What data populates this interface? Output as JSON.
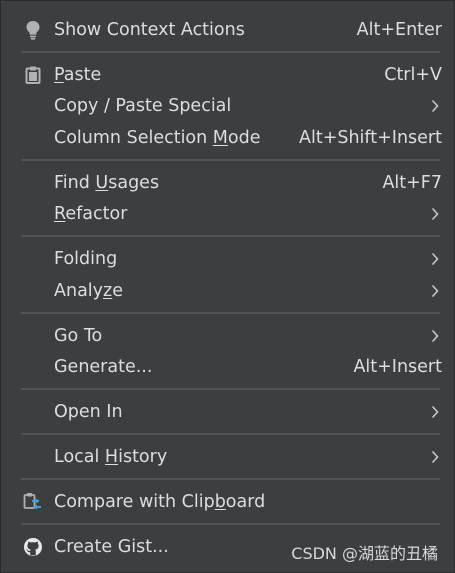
{
  "menu": {
    "items": [
      {
        "label": "Show Context Actions",
        "shortcut": "Alt+Enter",
        "icon": "lightbulb-icon"
      },
      {
        "pre": "",
        "mn": "P",
        "post": "aste",
        "shortcut": "Ctrl+V",
        "icon": "clipboard-paste-icon"
      },
      {
        "label": "Copy / Paste Special",
        "submenu": true
      },
      {
        "pre": "Column Selection ",
        "mn": "M",
        "post": "ode",
        "shortcut": "Alt+Shift+Insert"
      },
      {
        "pre": "Find ",
        "mn": "U",
        "post": "sages",
        "shortcut": "Alt+F7"
      },
      {
        "pre": "",
        "mn": "R",
        "post": "efactor",
        "submenu": true
      },
      {
        "label": "Folding",
        "submenu": true
      },
      {
        "pre": "Analy",
        "mn": "z",
        "post": "e",
        "submenu": true
      },
      {
        "label": "Go To",
        "submenu": true
      },
      {
        "label": "Generate...",
        "shortcut": "Alt+Insert"
      },
      {
        "label": "Open In",
        "submenu": true
      },
      {
        "pre": "Local ",
        "mn": "H",
        "post": "istory",
        "submenu": true
      },
      {
        "pre": "Compare with Clip",
        "mn": "b",
        "post": "oard",
        "icon": "compare-clipboard-icon"
      },
      {
        "label": "Create Gist...",
        "icon": "github-icon"
      }
    ]
  },
  "watermark": "CSDN @湖蓝的丑橘",
  "colors": {
    "background": "#3c3f41",
    "separator": "#515456",
    "text": "#dddddd",
    "icon": "#afb1b3"
  }
}
